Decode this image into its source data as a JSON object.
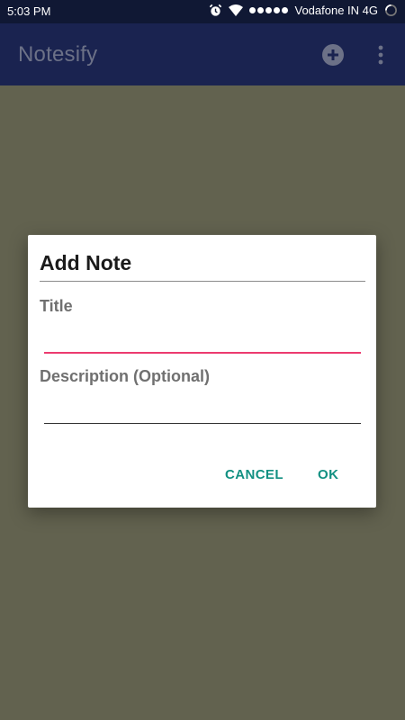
{
  "status_bar": {
    "time": "5:03 PM",
    "carrier": "Vodafone IN 4G",
    "icons": [
      "alarm-icon",
      "wifi-icon",
      "signal-dots",
      "loading-ring-icon"
    ]
  },
  "app_bar": {
    "title": "Notesify",
    "actions": [
      "add-circle-icon",
      "more-vert-icon"
    ]
  },
  "dialog": {
    "title": "Add Note",
    "title_field": {
      "label": "Title",
      "value": "",
      "placeholder": ""
    },
    "description_field": {
      "label": "Description (Optional)",
      "value": "",
      "placeholder": ""
    },
    "cancel_label": "CANCEL",
    "ok_label": "OK"
  },
  "colors": {
    "status_bar": "#101834",
    "app_bar": "#1a2350",
    "scrim_background": "#62624f",
    "accent_pink": "#ec3b6f",
    "button_teal": "#129082"
  }
}
